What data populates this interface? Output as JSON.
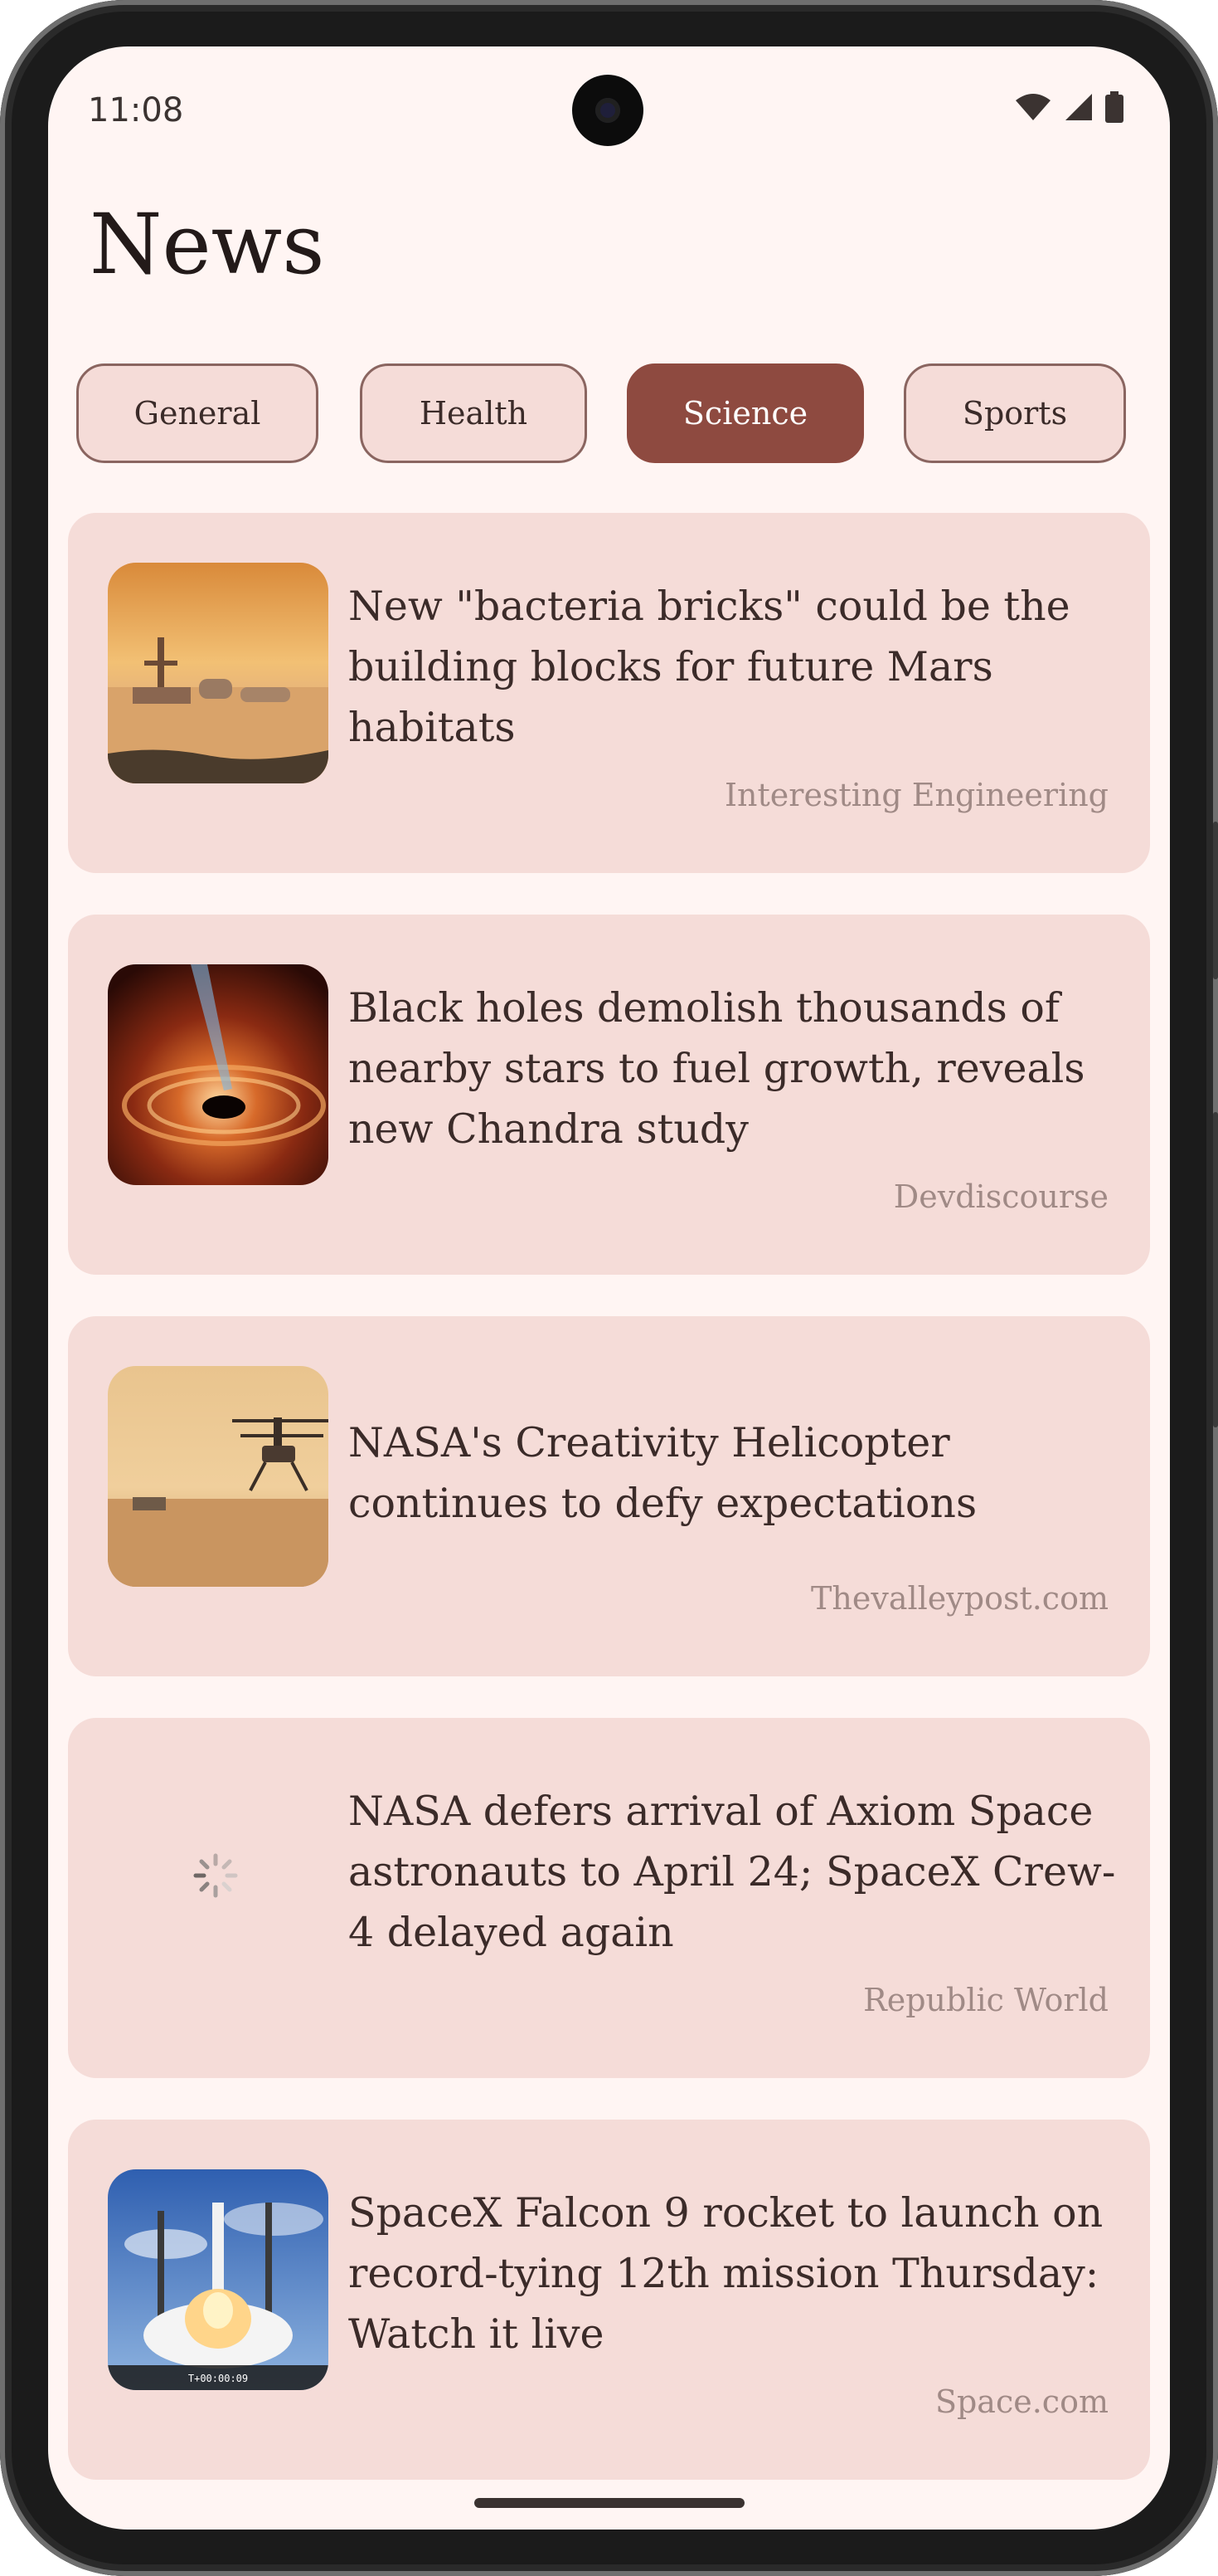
{
  "status_bar": {
    "time": "11:08",
    "icons": [
      "wifi-icon",
      "cell-signal-icon",
      "battery-icon"
    ]
  },
  "app": {
    "title": "News"
  },
  "categories": [
    {
      "label": "General",
      "selected": false
    },
    {
      "label": "Health",
      "selected": false
    },
    {
      "label": "Science",
      "selected": true
    },
    {
      "label": "Sports",
      "selected": false
    }
  ],
  "articles": [
    {
      "headline": "New \"bacteria bricks\" could be the building blocks for future Mars habitats",
      "source": "Interesting Engineering",
      "image": "mars-habitat-image"
    },
    {
      "headline": "Black holes demolish thousands of nearby stars to fuel growth, reveals new Chandra study",
      "source": "Devdiscourse",
      "image": "black-hole-image"
    },
    {
      "headline": "NASA's Creativity Helicopter continues to defy expectations",
      "source": "Thevalleypost.com",
      "image": "helicopter-image"
    },
    {
      "headline": "NASA defers arrival of Axiom Space astronauts to April 24; SpaceX Crew-4 delayed again",
      "source": "Republic World",
      "image": "loading-spinner-icon"
    },
    {
      "headline": "SpaceX Falcon 9 rocket to launch on record-tying 12th mission Thursday: Watch it live",
      "source": "Space.com",
      "image": "rocket-launch-image",
      "image_caption": "T+00:00:09"
    }
  ],
  "colors": {
    "background": "#fff5f3",
    "card": "#f5dcd8",
    "accent": "#8e4a40",
    "text": "#3b2b29",
    "muted": "#a08a86"
  }
}
